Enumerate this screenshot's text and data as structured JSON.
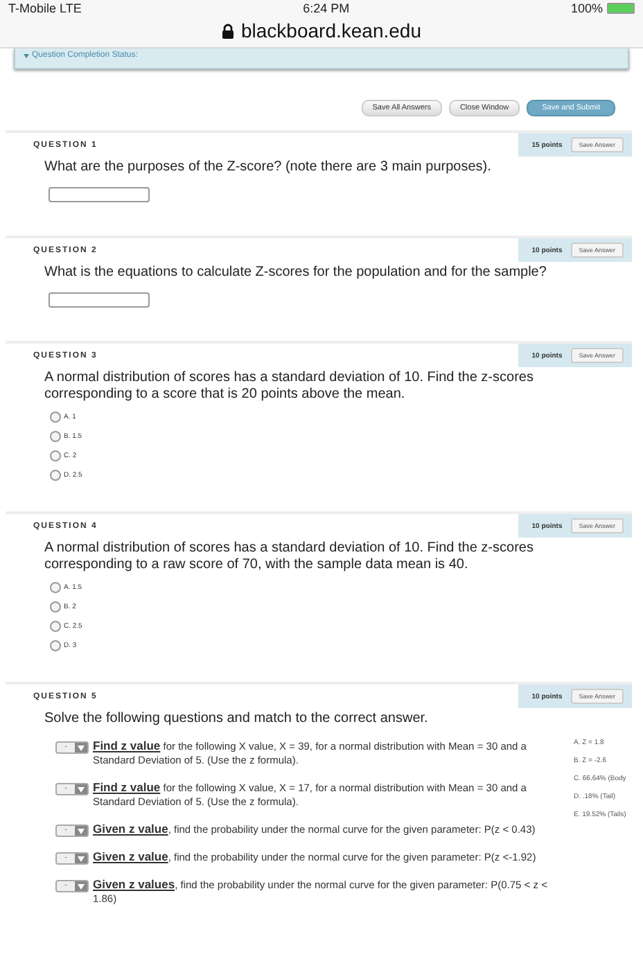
{
  "status_bar": {
    "carrier": "T-Mobile  LTE",
    "time": "6:24 PM",
    "battery": "100%"
  },
  "address_bar": {
    "url": "blackboard.kean.edu"
  },
  "completion_status": {
    "label": "Question Completion Status:",
    "expanded": true
  },
  "top_buttons": [
    {
      "label": "Save All Answers",
      "kind": "plain"
    },
    {
      "label": "Close Window",
      "kind": "plain"
    },
    {
      "label": "Save and Submit",
      "kind": "primary"
    }
  ],
  "questions": [
    {
      "title": "QUESTION 1",
      "points": "15 points",
      "save_label": "Save Answer",
      "kind": "text",
      "prompt": "What are the purposes of the Z-score? (note there are 3 main purposes)."
    },
    {
      "title": "QUESTION 2",
      "points": "10 points",
      "save_label": "Save Answer",
      "kind": "text",
      "prompt": "What is the equations to calculate Z-scores for the population and for the sample?"
    },
    {
      "title": "QUESTION 3",
      "points": "10 points",
      "save_label": "Save Answer",
      "kind": "choice",
      "prompt": "A normal distribution of scores has a standard deviation of 10.  Find the z-scores corresponding to a score that is 20 points above the mean.",
      "options": [
        {
          "label": "A. 1",
          "selected": false
        },
        {
          "label": "B. 1.5",
          "selected": false
        },
        {
          "label": "C. 2",
          "selected": false
        },
        {
          "label": "D. 2.5",
          "selected": false
        }
      ]
    },
    {
      "title": "QUESTION 4",
      "points": "10 points",
      "save_label": "Save Answer",
      "kind": "choice",
      "prompt": "A normal distribution of scores has a standard deviation of 10.  Find the z-scores corresponding to a raw score of 70, with the sample data mean is 40.",
      "options": [
        {
          "label": "A. 1.5",
          "selected": false
        },
        {
          "label": "B. 2",
          "selected": false
        },
        {
          "label": "C. 2.5",
          "selected": false
        },
        {
          "label": "D. 3",
          "selected": false
        }
      ]
    },
    {
      "title": "QUESTION 5",
      "points": "10 points",
      "save_label": "Save Answer",
      "kind": "matching",
      "prompt": "Solve the following questions and match to the correct answer.",
      "items": [
        {
          "value": "-",
          "text": "**Find z value** for the following X value, X = 39, for a normal distribution with Mean = 30 and a Standard Deviation of 5.  (Use the z formula)."
        },
        {
          "value": "-",
          "text": "**Find z value** for the following X value, X = 17, for a normal distribution with Mean = 30 and a Standard Deviation of 5.  (Use the z formula)."
        },
        {
          "value": "-",
          "text": "**Given z value**, find the probability under the normal curve for the given parameter:  P(z < 0.43)"
        },
        {
          "value": "-",
          "text": "**Given z value**, find the probability under the normal curve for the given parameter:  P(z <-1.92)"
        },
        {
          "value": "-",
          "text": "**Given z values**, find the probability under the normal curve for the given parameter:  P(0.75 < z < 1.86)"
        }
      ],
      "answers": [
        "A. Z = 1.8",
        "B. Z = -2.6",
        "C. 66.64% (Body",
        "D. .18% (Tail)",
        "E. 19.52% (Tails)"
      ]
    }
  ]
}
